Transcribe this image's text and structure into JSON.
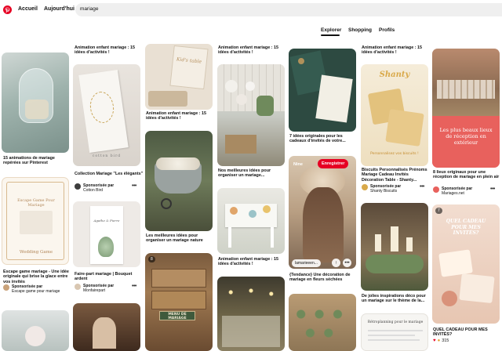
{
  "header": {
    "home_label": "Accueil",
    "today_label": "Aujourd'hui",
    "search_value": "mariage"
  },
  "tabs": {
    "explore": "Explorer",
    "shopping": "Shopping",
    "profiles": "Profils"
  },
  "pins": {
    "c1_p1": {
      "caption": "15 animations de mariage repérées sur Pinterest"
    },
    "c1_p2": {
      "image_title": "Escape Game Pour Mariage",
      "image_sub": "Wedding Game",
      "caption": "Escape game mariage - Une idée originale qui brise la glace entre vos invités",
      "sponsored_label": "Sponsorisée par",
      "sponsor": "Escape game pour mariage"
    },
    "c2_top": {
      "caption": "Animation enfant mariage : 15 idées d'activités !"
    },
    "c2_p1": {
      "image_text": "cotton bird",
      "caption": "Collection Mariage \"Les élégants\"",
      "sponsored_label": "Sponsorisée par",
      "sponsor": "Cotton Bird"
    },
    "c2_p2": {
      "image_text": "Agathe & Pierre",
      "caption": "Faire-part mariage | Bouquet ardent",
      "sponsored_label": "Sponsorisée par",
      "sponsor": "Monfairepart"
    },
    "c3_p1": {
      "image_text": "Kid's table",
      "caption": "Animation enfant mariage : 15 idées d'activités !"
    },
    "c3_p2": {
      "caption": "Les meilleures idées pour organiser un mariage nature"
    },
    "c3_p3": {
      "badge": "8",
      "sign_text": "MENU DE MARIAGE"
    },
    "c4_top": {
      "caption": "Animation enfant mariage : 15 idées d'activités !"
    },
    "c4_p1": {
      "caption": "Nos meilleures idées pour organiser un mariage..."
    },
    "c4_p2": {
      "caption": "Animation enfant mariage : 15 idées d'activités !"
    },
    "c5_p1": {
      "caption": "7 idées originales pour les cadeaux d'invités de votre..."
    },
    "c5_p2": {
      "save_context": "Nine",
      "save_button": "Enregistrer",
      "link_label": "lamarieeen...",
      "caption": "{Tendance} Une décoration de mariage en fleurs séchées"
    },
    "c6_top": {
      "caption": "Animation enfant mariage : 15 idées d'activités !"
    },
    "c6_p1": {
      "image_title": "Shanty",
      "image_sub": "Personnalisez vos biscuits !",
      "caption": "Biscuits Personnalisés Prénoms Mariage Cadeau Invités Décoration Table - Shanty...",
      "sponsored_label": "Sponsorisée par",
      "sponsor": "Shanty Biscuits"
    },
    "c6_p2": {
      "caption": "De jolies inspirations déco pour un mariage sur le thème de la..."
    },
    "c6_p3": {
      "image_text": "Rétroplanning pour le mariage"
    },
    "c7_p1": {
      "image_text": "Les plus beaux lieux de réception en extérieur",
      "caption": "8 lieux originaux pour une réception de mariage en plein air",
      "sponsored_label": "Sponsorisée par",
      "sponsor": "Mariages.net"
    },
    "c7_p2": {
      "badge": "7",
      "image_text": "QUEL CADEAU POUR MES INVITÉS?",
      "caption": "QUEL CADEAU POUR MES INVITÉS?",
      "reactions": "315"
    }
  },
  "colors": {
    "brand": "#e60023",
    "search_bg": "#efefef"
  }
}
